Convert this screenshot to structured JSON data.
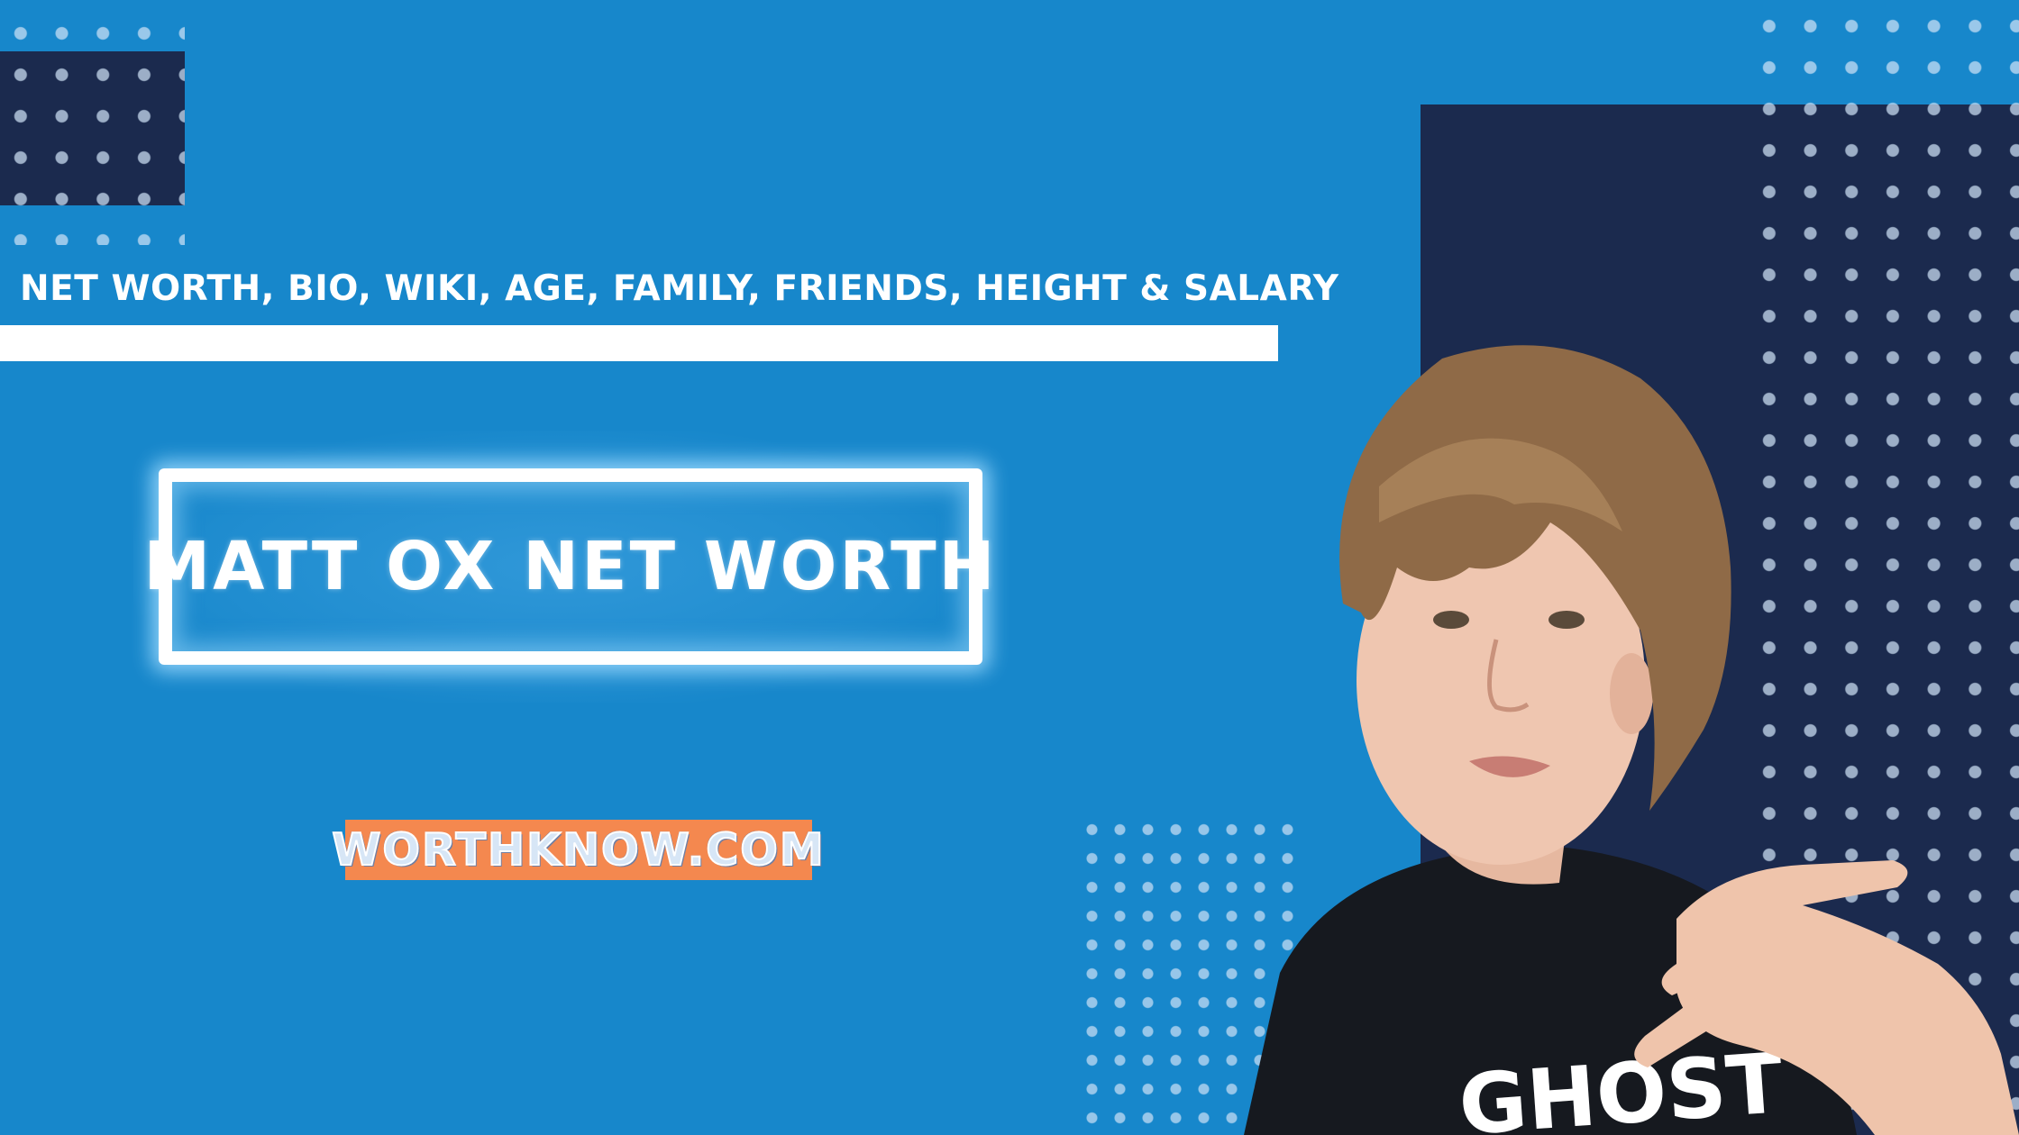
{
  "subtitle": "NET WORTH, BIO, WIKI, AGE, FAMILY, FRIENDS, HEIGHT & SALARY",
  "title": "MATT OX NET WORTH",
  "site": "WORTHKNOW.COM",
  "shirt_text": "GHOST",
  "colors": {
    "background": "#1787cb",
    "navy": "#1b2a4e",
    "badge": "#f4884f",
    "white": "#ffffff"
  }
}
